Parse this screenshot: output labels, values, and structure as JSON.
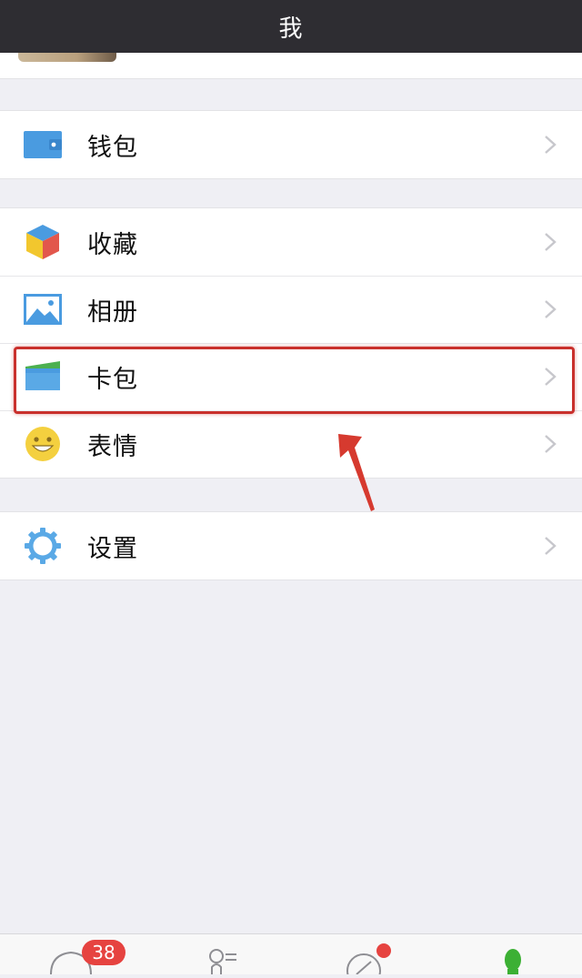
{
  "header": {
    "title": "我"
  },
  "groups": {
    "wallet": [
      {
        "label": "钱包",
        "icon": "wallet-icon"
      }
    ],
    "main": [
      {
        "label": "收藏",
        "icon": "favorites-cube-icon"
      },
      {
        "label": "相册",
        "icon": "photo-album-icon"
      },
      {
        "label": "卡包",
        "icon": "card-pack-icon"
      },
      {
        "label": "表情",
        "icon": "smiley-icon"
      }
    ],
    "settings": [
      {
        "label": "设置",
        "icon": "gear-icon"
      }
    ]
  },
  "tabbar": {
    "chats_badge": "38",
    "tabs": [
      {
        "icon": "chat-bubble-icon"
      },
      {
        "icon": "contacts-icon"
      },
      {
        "icon": "discover-compass-icon"
      },
      {
        "icon": "me-person-icon"
      }
    ]
  },
  "colors": {
    "nav_bg": "#2e2d32",
    "page_bg": "#efeff4",
    "highlight": "#c9302c",
    "badge": "#e64340",
    "accent_green": "#3cb034"
  }
}
